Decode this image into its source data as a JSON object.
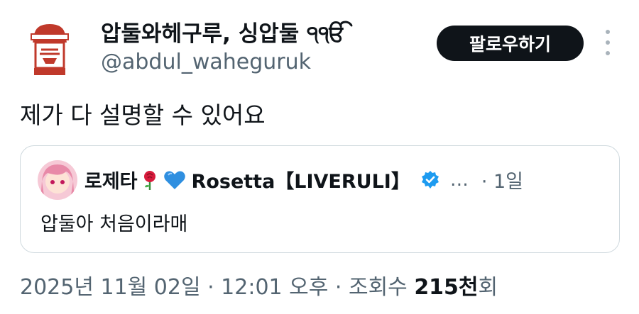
{
  "author": {
    "display_name": "압둘와헤구루, 싱압둘 ੧ੴ",
    "handle": "@abdul_waheguruk",
    "avatar_icon": "mustached-man-logo-icon"
  },
  "follow_button": {
    "label": "팔로우하기"
  },
  "tweet": {
    "text": "제가 다 설명할 수 있어요"
  },
  "quote": {
    "name_prefix": "로제타",
    "name_suffix": "Rosetta【LIVERULI】",
    "emojis": [
      "rose-icon",
      "blue-heart-icon"
    ],
    "more": "…",
    "age": "· 1일",
    "text": "압둘아 처음이라매",
    "verified": true
  },
  "meta": {
    "date": "2025년 11월 02일 · 12:01 오후 · 조회수 ",
    "views": "215천",
    "views_suffix": "회"
  },
  "colors": {
    "primary_text": "#0f1419",
    "secondary_text": "#536471",
    "verified": "#1d9bf0",
    "border": "#cfd9de"
  }
}
